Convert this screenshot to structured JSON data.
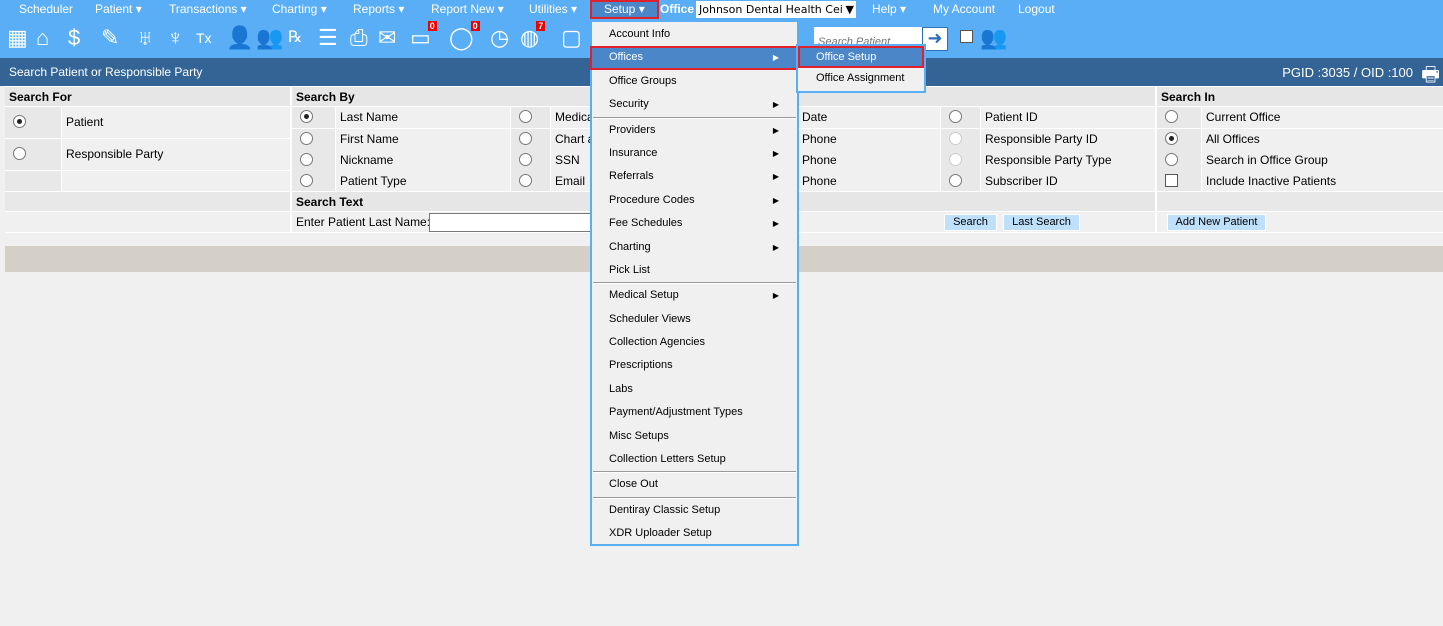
{
  "nav": {
    "items": [
      {
        "label": "Scheduler",
        "caret": false
      },
      {
        "label": "Patient",
        "caret": true
      },
      {
        "label": "Transactions",
        "caret": true
      },
      {
        "label": "Charting",
        "caret": true
      },
      {
        "label": "Reports",
        "caret": true
      },
      {
        "label": "Report New",
        "caret": true
      },
      {
        "label": "Utilities",
        "caret": true
      }
    ],
    "setup": "Setup ▾",
    "office_label": "Office",
    "office_value": "Johnson Dental Health Cei",
    "help": "Help ▾",
    "my_account": "My Account",
    "logout": "Logout"
  },
  "toolbar": {
    "badges": {
      "messages": "0",
      "chat": "0",
      "alerts": "7"
    },
    "search_placeholder": "Search Patient"
  },
  "header": {
    "title": "Search Patient or Responsible Party",
    "ids": "PGID :3035  /  OID :100"
  },
  "search_for": {
    "title": "Search For",
    "options": [
      "Patient",
      "Responsible Party"
    ]
  },
  "search_by": {
    "title": "Search By",
    "col1": [
      "Last Name",
      "First Name",
      "Nickname",
      "Patient Type"
    ],
    "col2": [
      "Medica",
      "Chart a",
      "SSN",
      "Email"
    ],
    "col3": [
      "Date",
      "Phone",
      "Phone",
      "Phone"
    ],
    "col4": [
      "Patient ID",
      "Responsible Party ID",
      "Responsible Party Type",
      "Subscriber ID"
    ]
  },
  "search_in": {
    "title": "Search In",
    "options": [
      "Current Office",
      "All Offices",
      "Search in Office Group",
      "Include Inactive Patients"
    ]
  },
  "search_text": {
    "title": "Search Text",
    "label": "Enter Patient Last Name:",
    "value": ""
  },
  "buttons": {
    "search": "Search",
    "last_search": "Last Search",
    "add_new_patient": "Add New Patient"
  },
  "setup_menu": {
    "items": [
      "Account Info",
      "Offices",
      "Office Groups",
      "Security",
      "Providers",
      "Insurance",
      "Referrals",
      "Procedure Codes",
      "Fee Schedules",
      "Charting",
      "Pick List",
      "Medical Setup",
      "Scheduler Views",
      "Collection Agencies",
      "Prescriptions",
      "Labs",
      "Payment/Adjustment Types",
      "Misc Setups",
      "Collection Letters Setup",
      "Close Out",
      "Dentiray Classic Setup",
      "XDR Uploader Setup"
    ]
  },
  "offices_submenu": {
    "items": [
      "Office Setup",
      "Office Assignment"
    ]
  },
  "colors": {
    "nav_blue": "#5aaef6",
    "header_blue": "#336495",
    "highlight": "#4a86c8",
    "outline_red": "#e0202a"
  }
}
